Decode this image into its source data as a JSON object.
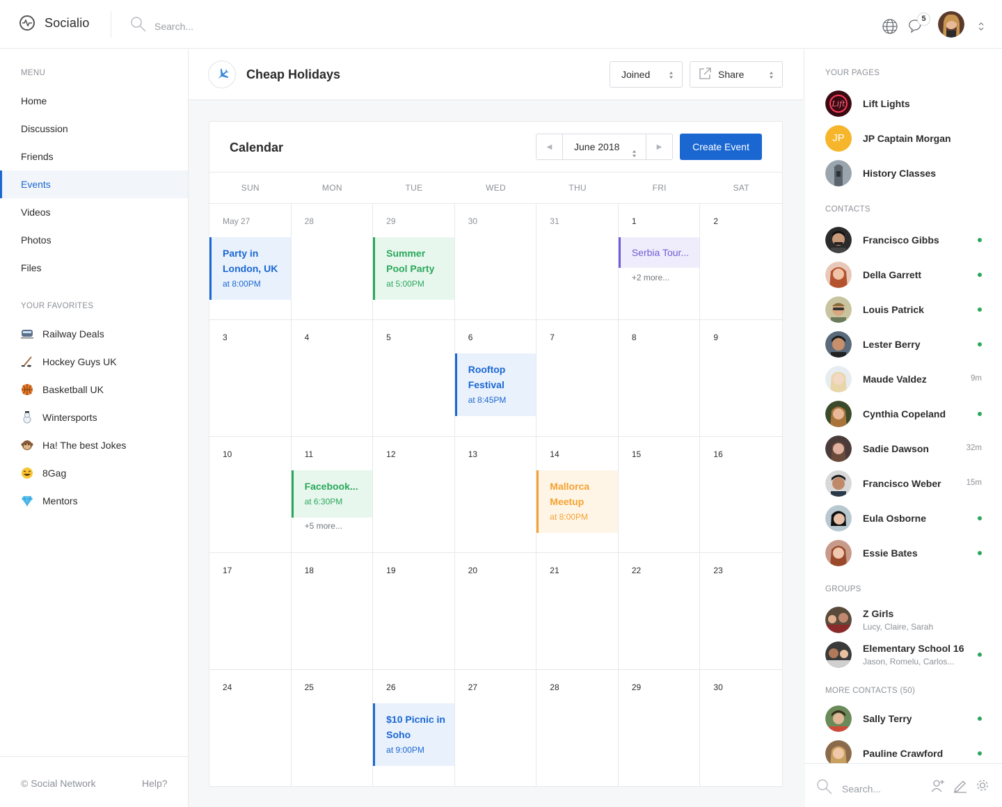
{
  "app": {
    "name": "Socialio",
    "search_placeholder": "Search...",
    "notification_count": "5"
  },
  "sidebar": {
    "menu_label": "MENU",
    "menu": [
      {
        "label": "Home",
        "active": false
      },
      {
        "label": "Discussion",
        "active": false
      },
      {
        "label": "Friends",
        "active": false
      },
      {
        "label": "Events",
        "active": true
      },
      {
        "label": "Videos",
        "active": false
      },
      {
        "label": "Photos",
        "active": false
      },
      {
        "label": "Files",
        "active": false
      }
    ],
    "favorites_label": "YOUR FAVORITES",
    "favorites": [
      {
        "label": "Railway Deals",
        "icon": "train-icon"
      },
      {
        "label": "Hockey Guys UK",
        "icon": "hockey-icon"
      },
      {
        "label": "Basketball UK",
        "icon": "basketball-icon"
      },
      {
        "label": "Wintersports",
        "icon": "snowman-icon"
      },
      {
        "label": "Ha! The best Jokes",
        "icon": "monkey-icon"
      },
      {
        "label": "8Gag",
        "icon": "laughing-icon"
      },
      {
        "label": "Mentors",
        "icon": "diamond-icon"
      }
    ],
    "copyright": "© Social Network",
    "help": "Help?"
  },
  "page": {
    "title": "Cheap Holidays",
    "icon": "airplane-icon",
    "joined_label": "Joined",
    "share_label": "Share"
  },
  "calendar": {
    "title": "Calendar",
    "month": "June 2018",
    "create_label": "Create Event",
    "weekdays": [
      "SUN",
      "MON",
      "TUE",
      "WED",
      "THU",
      "FRI",
      "SAT"
    ],
    "days": [
      "May 27",
      "28",
      "29",
      "30",
      "31",
      "1",
      "2",
      "3",
      "4",
      "5",
      "6",
      "7",
      "8",
      "9",
      "10",
      "11",
      "12",
      "13",
      "14",
      "15",
      "16",
      "17",
      "18",
      "19",
      "20",
      "21",
      "22",
      "23",
      "24",
      "25",
      "26",
      "27",
      "28",
      "29",
      "30"
    ],
    "events": {
      "party": {
        "title": "Party in London, UK",
        "time": "at 8:00PM"
      },
      "summer": {
        "title": "Summer Pool Party",
        "time": "at 5:00PM"
      },
      "serbia": {
        "title": "Serbia Tour...",
        "more": "+2 more..."
      },
      "rooftop": {
        "title": "Rooftop Festival",
        "time": "at 8:45PM"
      },
      "facebook": {
        "title": "Facebook...",
        "time": "at 6:30PM",
        "more": "+5 more..."
      },
      "mallorca": {
        "title": "Mallorca Meetup",
        "time": "at 8:00PM"
      },
      "picnic": {
        "title": "$10 Picnic in Soho",
        "time": "at 9:00PM"
      }
    },
    "colors": {
      "blue": "#1a67d2",
      "green": "#2aa85a",
      "purple": "#6f5bd6",
      "orange": "#f5a231"
    }
  },
  "rightbar": {
    "pages_label": "YOUR PAGES",
    "pages": [
      {
        "name": "Lift Lights"
      },
      {
        "name": "JP Captain Morgan",
        "initials": "JP"
      },
      {
        "name": "History Classes"
      }
    ],
    "contacts_label": "CONTACTS",
    "contacts": [
      {
        "name": "Francisco Gibbs",
        "status": "online"
      },
      {
        "name": "Della Garrett",
        "status": "online"
      },
      {
        "name": "Louis Patrick",
        "status": "online"
      },
      {
        "name": "Lester Berry",
        "status": "online"
      },
      {
        "name": "Maude Valdez",
        "status": "9m"
      },
      {
        "name": "Cynthia Copeland",
        "status": "online"
      },
      {
        "name": "Sadie Dawson",
        "status": "32m"
      },
      {
        "name": "Francisco Weber",
        "status": "15m"
      },
      {
        "name": "Eula Osborne",
        "status": "online"
      },
      {
        "name": "Essie Bates",
        "status": "online"
      }
    ],
    "groups_label": "GROUPS",
    "groups": [
      {
        "name": "Z Girls",
        "members": "Lucy, Claire, Sarah",
        "status": "none"
      },
      {
        "name": "Elementary School 16",
        "members": "Jason, Romelu, Carlos...",
        "status": "online"
      }
    ],
    "more_contacts_label": "MORE CONTACTS (50)",
    "more_contacts": [
      {
        "name": "Sally Terry",
        "status": "online"
      },
      {
        "name": "Pauline Crawford",
        "status": "online"
      }
    ],
    "search_placeholder": "Search..."
  }
}
